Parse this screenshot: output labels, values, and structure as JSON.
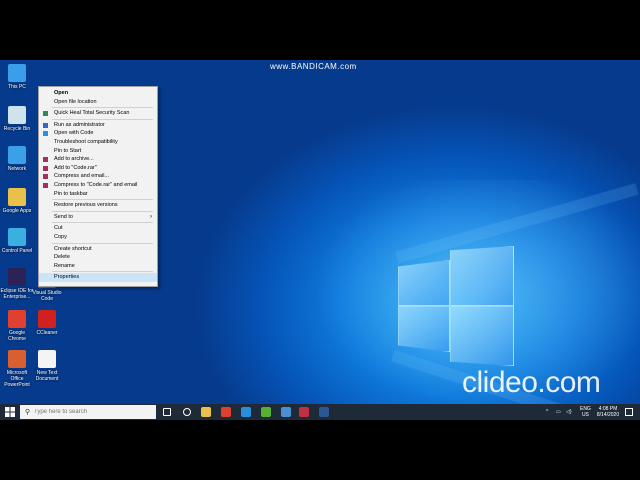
{
  "watermarks": {
    "top": "www.BANDICAM.com",
    "bottom": "clideo.com"
  },
  "desktop_icons": [
    {
      "label": "This PC",
      "icon": "this-pc-icon",
      "color": "#3a9fe8"
    },
    {
      "label": "Recycle Bin",
      "icon": "recycle-bin-icon",
      "color": "#cfe3ef"
    },
    {
      "label": "Network",
      "icon": "network-icon",
      "color": "#3aa0e8"
    },
    {
      "label": "Google Apps",
      "icon": "folder-icon",
      "color": "#e8c04a"
    },
    {
      "label": "Control Panel",
      "icon": "control-panel-icon",
      "color": "#3ab0e0"
    },
    {
      "label": "Eclipse IDE for Enterprise...",
      "icon": "eclipse-icon",
      "color": "#2c2255"
    },
    {
      "label": "Google Chrome",
      "icon": "chrome-icon",
      "color": "#e04030"
    },
    {
      "label": "CCleaner",
      "icon": "ccleaner-icon",
      "color": "#d02020"
    },
    {
      "label": "Microsoft Office PowerPoint",
      "icon": "powerpoint-icon",
      "color": "#d86030"
    },
    {
      "label": "New Text Document",
      "icon": "text-file-icon",
      "color": "#f4f4f4"
    },
    {
      "label": "Visual Studio Code",
      "icon": "vscode-icon",
      "color": "#2a8ee0"
    }
  ],
  "context_menu": {
    "items": [
      {
        "label": "Open",
        "bold": true,
        "icon": ""
      },
      {
        "label": "Open file location",
        "icon": ""
      },
      {
        "sep": true
      },
      {
        "label": "Quick Heal Total Security Scan",
        "icon": "shield-icon",
        "color": "#2e8b57"
      },
      {
        "sep": true
      },
      {
        "label": "Run as administrator",
        "icon": "admin-shield-icon",
        "color": "#3366cc"
      },
      {
        "label": "Open with Code",
        "icon": "vscode-icon",
        "color": "#2a8ee0"
      },
      {
        "label": "Troubleshoot compatibility",
        "icon": ""
      },
      {
        "label": "Pin to Start",
        "icon": ""
      },
      {
        "label": "Add to archive...",
        "icon": "winrar-icon",
        "color": "#a03060"
      },
      {
        "label": "Add to \"Code.rar\"",
        "icon": "winrar-icon",
        "color": "#a03060"
      },
      {
        "label": "Compress and email...",
        "icon": "winrar-icon",
        "color": "#a03060"
      },
      {
        "label": "Compress to \"Code.rar\" and email",
        "icon": "winrar-icon",
        "color": "#a03060"
      },
      {
        "label": "Pin to taskbar",
        "icon": ""
      },
      {
        "sep": true
      },
      {
        "label": "Restore previous versions",
        "icon": ""
      },
      {
        "sep": true
      },
      {
        "label": "Send to",
        "icon": "",
        "submenu": true
      },
      {
        "sep": true
      },
      {
        "label": "Cut",
        "icon": ""
      },
      {
        "label": "Copy",
        "icon": ""
      },
      {
        "sep": true
      },
      {
        "label": "Create shortcut",
        "icon": ""
      },
      {
        "label": "Delete",
        "icon": ""
      },
      {
        "label": "Rename",
        "icon": ""
      },
      {
        "sep": true
      },
      {
        "label": "Properties",
        "icon": "",
        "hover": true
      }
    ]
  },
  "taskbar": {
    "search_placeholder": "Type here to search",
    "apps": [
      {
        "icon": "task-view-icon",
        "color": "#ffffff"
      },
      {
        "icon": "cortana-icon",
        "color": "#ffffff"
      },
      {
        "icon": "file-explorer-icon",
        "color": "#e8c04a"
      },
      {
        "icon": "chrome-icon",
        "color": "#e04030"
      },
      {
        "icon": "edge-icon",
        "color": "#2a8ee0"
      },
      {
        "icon": "notepad-plus-icon",
        "color": "#58b030"
      },
      {
        "icon": "store-icon",
        "color": "#4a90d0"
      },
      {
        "icon": "bandicam-icon",
        "color": "#c03040"
      },
      {
        "icon": "word-icon",
        "color": "#2b5797"
      }
    ],
    "tray": {
      "lang": "ENG",
      "region": "US",
      "time": "4:08 PM",
      "date": "8/14/2020"
    }
  }
}
